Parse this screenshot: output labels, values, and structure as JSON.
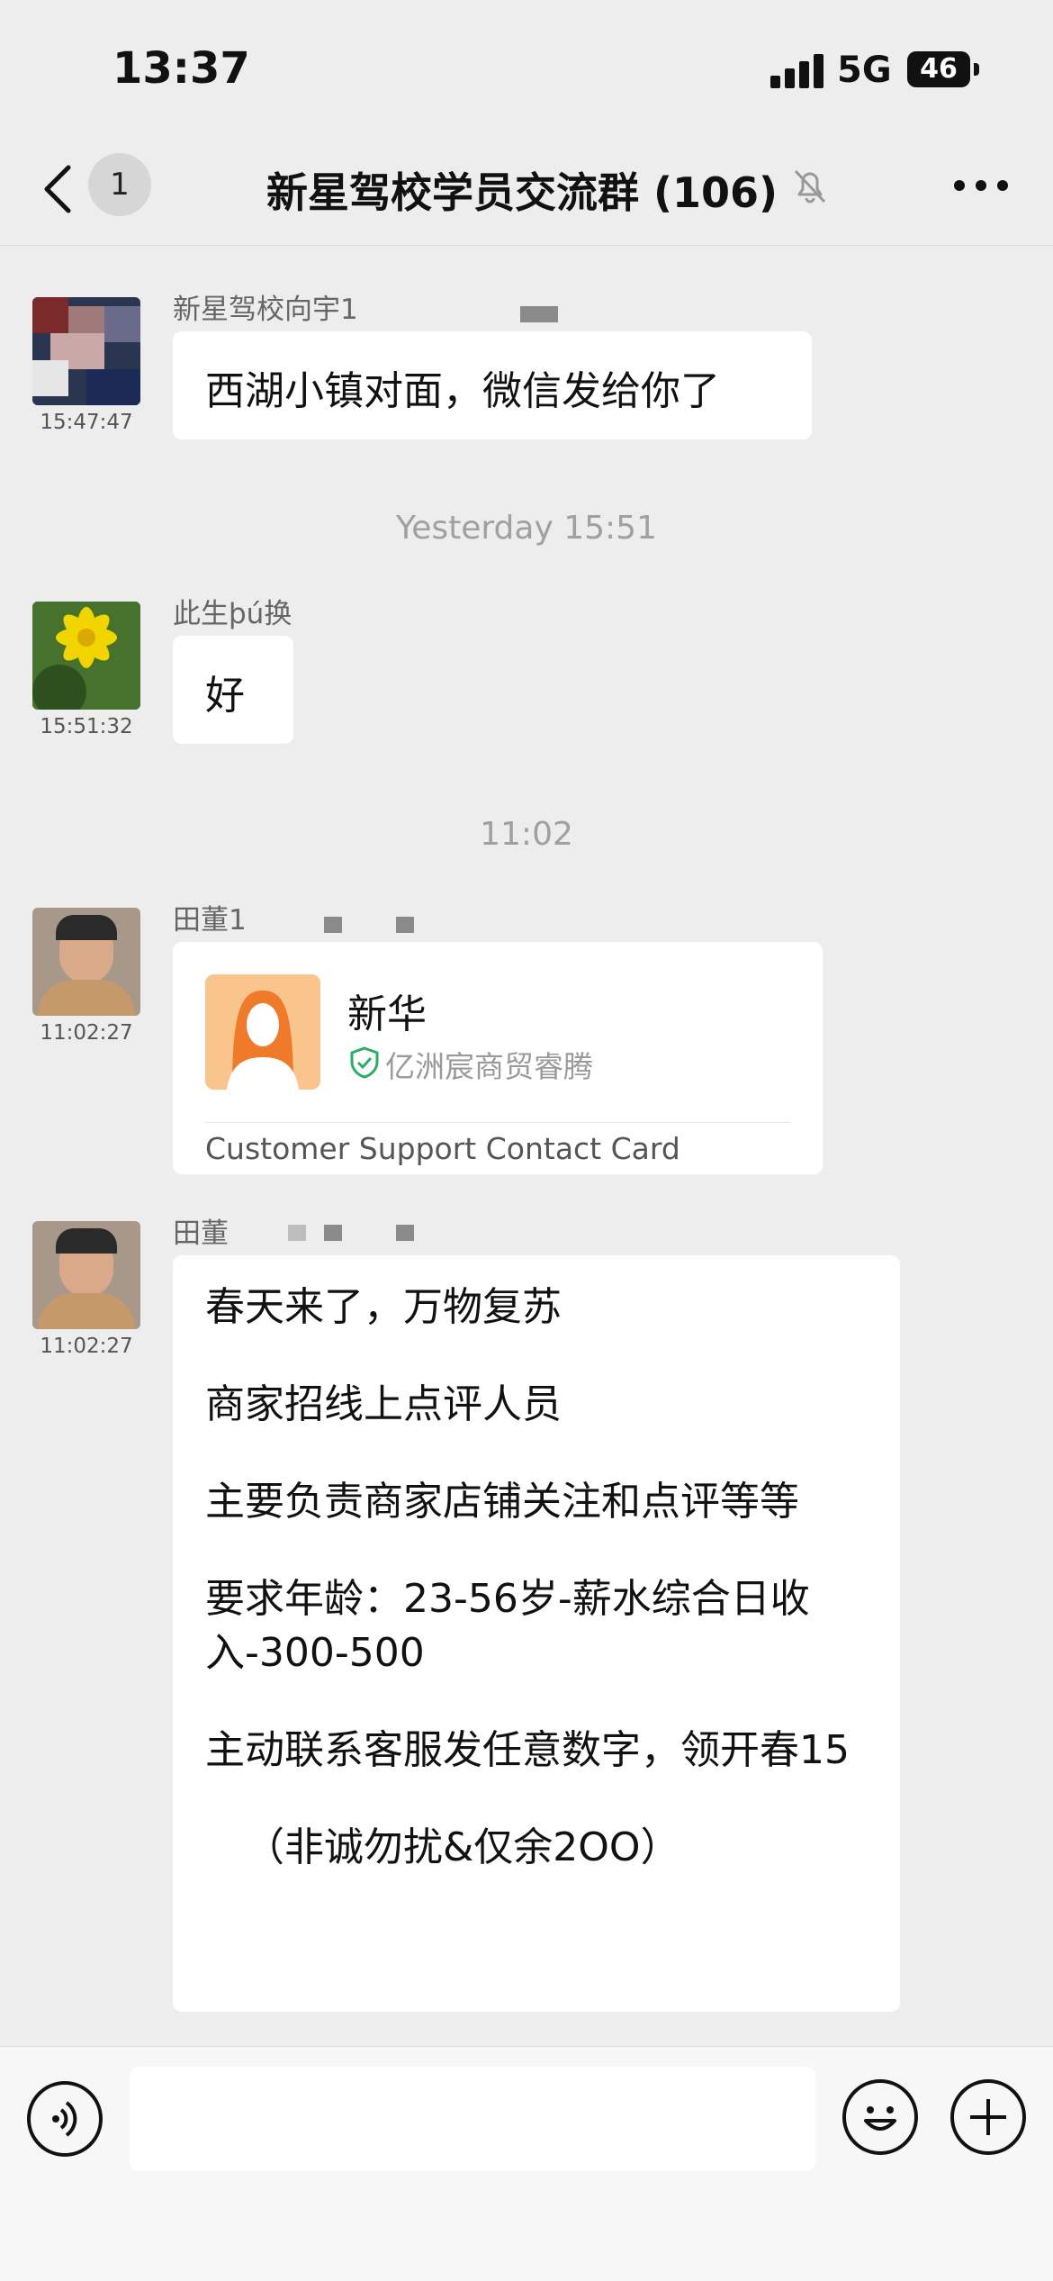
{
  "status_bar": {
    "time": "13:37",
    "network": "5G",
    "battery": "46"
  },
  "nav": {
    "unread_count": "1",
    "title": "新星驾校学员交流群 (106)"
  },
  "messages": [
    {
      "sender": "新星驾校向宇1",
      "time": "15:47:47",
      "text": "西湖小镇对面，微信发给你了"
    },
    {
      "divider": "Yesterday 15:51"
    },
    {
      "sender": "此生þú换",
      "time": "15:51:32",
      "text": "好"
    },
    {
      "divider": "11:02"
    },
    {
      "sender": "田董1",
      "time": "11:02:27",
      "card": {
        "name": "新华",
        "org": "亿洲宸商贸睿腾",
        "footer": "Customer Support Contact Card"
      }
    },
    {
      "sender": "田董",
      "time": "11:02:27",
      "lines": [
        "春天来了，万物复苏",
        "商家招线上点评人员",
        "主要负责商家店铺关注和点评等等",
        "要求年龄：23-56岁-薪水综合日收入-300-500",
        "主动联系客服发任意数字，领开春15",
        "（非诚勿扰&仅余2OO）"
      ]
    }
  ],
  "colors": {
    "background": "#ededed",
    "bubble": "#ffffff",
    "verified": "#2aae67"
  }
}
